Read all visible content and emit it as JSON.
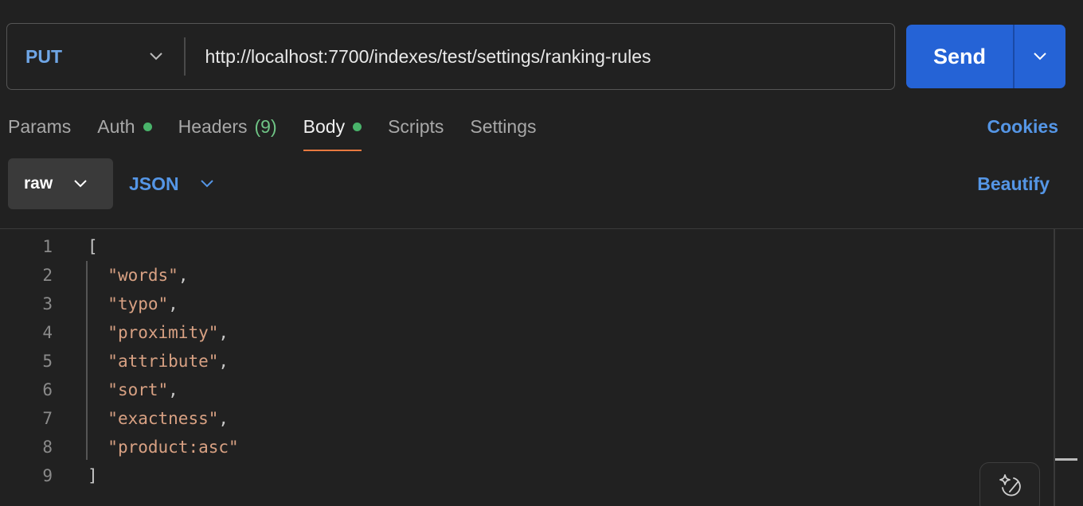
{
  "request": {
    "method": "PUT",
    "url": "http://localhost:7700/indexes/test/settings/ranking-rules"
  },
  "send": {
    "label": "Send"
  },
  "tabs": [
    {
      "label": "Params"
    },
    {
      "label": "Auth",
      "dot": true
    },
    {
      "label": "Headers",
      "count": "(9)"
    },
    {
      "label": "Body",
      "dot": true,
      "active": true
    },
    {
      "label": "Scripts"
    },
    {
      "label": "Settings"
    }
  ],
  "cookies_label": "Cookies",
  "body": {
    "mode": "raw",
    "language": "JSON",
    "beautify_label": "Beautify"
  },
  "editor": {
    "line_numbers": [
      "1",
      "2",
      "3",
      "4",
      "5",
      "6",
      "7",
      "8",
      "9"
    ],
    "lines": [
      {
        "pre": "[",
        "str": "",
        "post": ""
      },
      {
        "pre": "  ",
        "str": "\"words\"",
        "post": ","
      },
      {
        "pre": "  ",
        "str": "\"typo\"",
        "post": ","
      },
      {
        "pre": "  ",
        "str": "\"proximity\"",
        "post": ","
      },
      {
        "pre": "  ",
        "str": "\"attribute\"",
        "post": ","
      },
      {
        "pre": "  ",
        "str": "\"sort\"",
        "post": ","
      },
      {
        "pre": "  ",
        "str": "\"exactness\"",
        "post": ","
      },
      {
        "pre": "  ",
        "str": "\"product:asc\"",
        "post": ""
      },
      {
        "pre": "]",
        "str": "",
        "post": ""
      }
    ]
  },
  "icons": {
    "method_dropdown": "chevron-down-icon",
    "send_dropdown": "chevron-down-icon",
    "ai_assist": "sparkle-icon"
  },
  "colors": {
    "accent_blue": "#2563d6",
    "method_blue": "#6fa6e6",
    "link_blue": "#5596e6",
    "active_tab_underline": "#e8793f",
    "status_dot_green": "#49b36a",
    "string_color": "#d8a183"
  }
}
